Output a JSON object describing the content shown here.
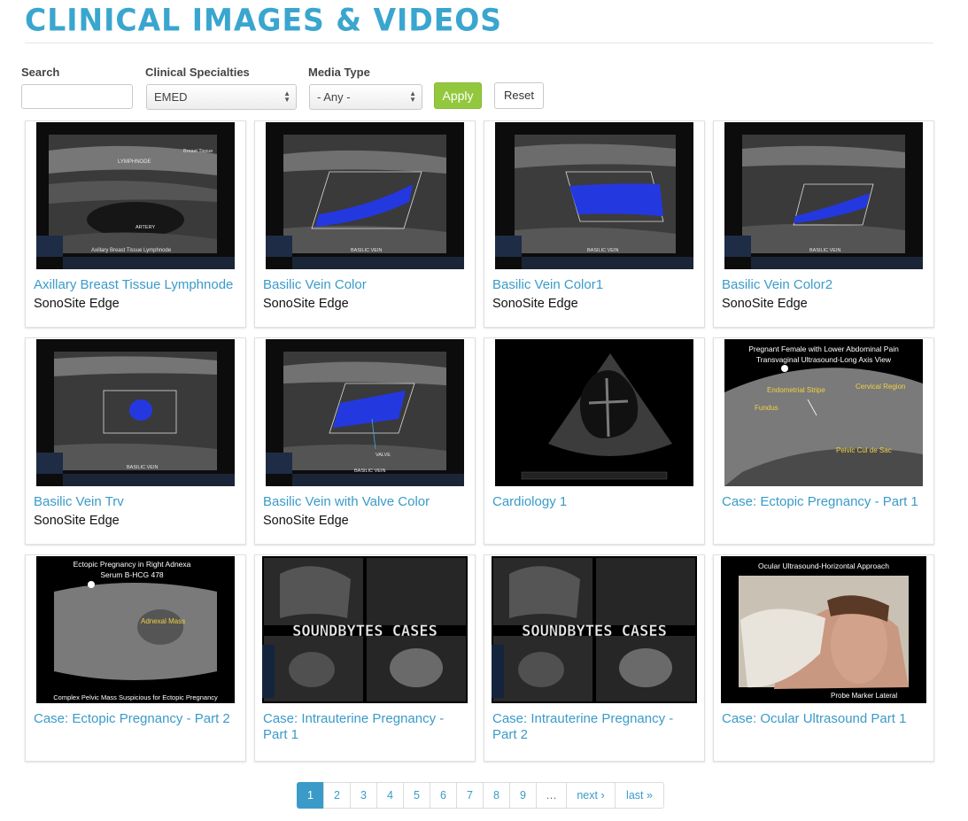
{
  "header": {
    "title": "CLINICAL IMAGES & VIDEOS"
  },
  "filters": {
    "search_label": "Search",
    "search_value": "",
    "specialties_label": "Clinical Specialties",
    "specialties_value": "EMED",
    "media_label": "Media Type",
    "media_value": "- Any -",
    "apply_label": "Apply",
    "reset_label": "Reset"
  },
  "colors": {
    "accent": "#3aa6cf",
    "link": "#3a9bc8",
    "apply": "#93c83e",
    "doppler": "#2438e0"
  },
  "cards": [
    {
      "title": "Axillary Breast Tissue Lymphnode",
      "subtitle": "SonoSite Edge",
      "thumb_type": "ultrasound-gray",
      "captions": [
        "LYMPHNODE",
        "Breast Tissue",
        "ARTERY",
        "Axillary Breast Tissue Lymphnode"
      ]
    },
    {
      "title": "Basilic Vein Color",
      "subtitle": "SonoSite Edge",
      "thumb_type": "ultrasound-doppler",
      "captions": [
        "BASILIC VEIN"
      ]
    },
    {
      "title": "Basilic Vein Color1",
      "subtitle": "SonoSite Edge",
      "thumb_type": "ultrasound-doppler",
      "captions": [
        "BASILIC VEIN"
      ]
    },
    {
      "title": "Basilic Vein Color2",
      "subtitle": "SonoSite Edge",
      "thumb_type": "ultrasound-doppler",
      "captions": [
        "BASILIC VEIN"
      ]
    },
    {
      "title": "Basilic Vein Trv",
      "subtitle": "SonoSite Edge",
      "thumb_type": "ultrasound-doppler-transverse",
      "captions": [
        "BASILIC VEIN"
      ]
    },
    {
      "title": "Basilic Vein with Valve Color",
      "subtitle": "SonoSite Edge",
      "thumb_type": "ultrasound-doppler",
      "captions": [
        "VALVE",
        "BASILIC VEIN"
      ]
    },
    {
      "title": "Cardiology 1",
      "subtitle": "",
      "thumb_type": "ultrasound-cardiac",
      "captions": []
    },
    {
      "title": "Case: Ectopic Pregnancy - Part 1",
      "subtitle": "",
      "thumb_type": "ultrasound-annotated",
      "captions": [
        "Pregnant Female with Lower Abdominal Pain",
        "Transvaginal Ultrasound-Long Axis View",
        "Endometrial Stripe",
        "Cervical Region",
        "Fundus",
        "Pelvic Cul de Sac"
      ]
    },
    {
      "title": "Case: Ectopic Pregnancy - Part 2",
      "subtitle": "",
      "thumb_type": "ultrasound-annotated",
      "captions": [
        "Ectopic Pregnancy in Right Adnexa",
        "Serum B-HCG 478",
        "Adnexal Mass",
        "Complex Pelvic Mass Suspicious for Ectopic Pregnancy"
      ]
    },
    {
      "title": "Case: Intrauterine Pregnancy - Part 1",
      "subtitle": "",
      "thumb_type": "video-soundbytes",
      "captions": [
        "SOUNDBYTES CASES"
      ]
    },
    {
      "title": "Case: Intrauterine Pregnancy - Part 2",
      "subtitle": "",
      "thumb_type": "video-soundbytes",
      "captions": [
        "SOUNDBYTES CASES"
      ]
    },
    {
      "title": "Case: Ocular Ultrasound Part 1",
      "subtitle": "",
      "thumb_type": "video-ocular",
      "captions": [
        "Ocular Ultrasound-Horizontal Approach",
        "Probe Marker Lateral"
      ]
    }
  ],
  "pagination": {
    "pages": [
      "1",
      "2",
      "3",
      "4",
      "5",
      "6",
      "7",
      "8",
      "9"
    ],
    "current": "1",
    "ellipsis": "…",
    "next_label": "next ›",
    "last_label": "last »"
  }
}
